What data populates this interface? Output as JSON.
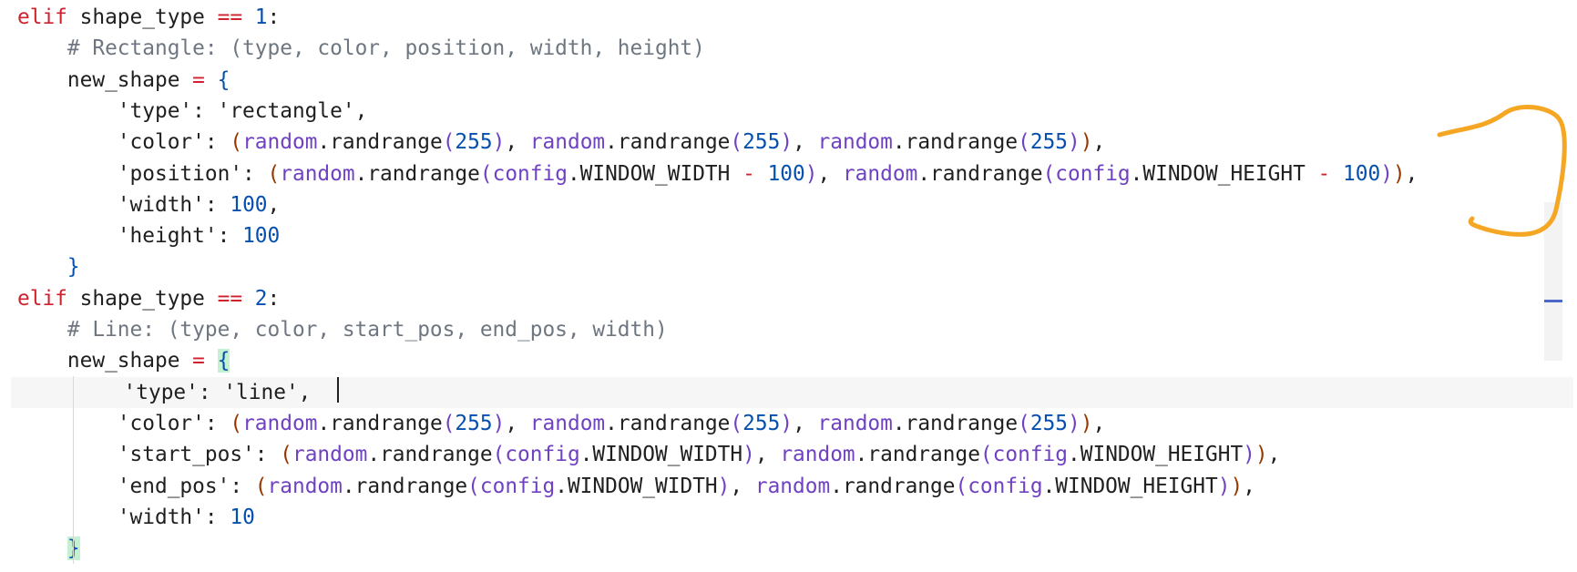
{
  "editor": {
    "lines": [
      {
        "indent": "",
        "tokens": [
          [
            "kw",
            "elif"
          ],
          [
            "pl",
            " shape_type "
          ],
          [
            "op",
            "=="
          ],
          [
            "pl",
            " "
          ],
          [
            "num",
            "1"
          ],
          [
            "pl",
            ":"
          ]
        ]
      },
      {
        "indent": "    ",
        "tokens": [
          [
            "cm",
            "# Rectangle: (type, color, position, width, height)"
          ]
        ]
      },
      {
        "indent": "    ",
        "tokens": [
          [
            "pl",
            "new_shape "
          ],
          [
            "op",
            "="
          ],
          [
            "pl",
            " "
          ],
          [
            "br1",
            "{"
          ]
        ]
      },
      {
        "indent": "        ",
        "tokens": [
          [
            "pl",
            "'type': 'rectangle',"
          ]
        ]
      },
      {
        "indent": "        ",
        "tokens": [
          [
            "pl",
            "'color': "
          ],
          [
            "br2",
            "("
          ],
          [
            "fn",
            "random"
          ],
          [
            "pl",
            ".randrange"
          ],
          [
            "fn",
            "("
          ],
          [
            "num",
            "255"
          ],
          [
            "fn",
            ")"
          ],
          [
            "pl",
            ", "
          ],
          [
            "fn",
            "random"
          ],
          [
            "pl",
            ".randrange"
          ],
          [
            "fn",
            "("
          ],
          [
            "num",
            "255"
          ],
          [
            "fn",
            ")"
          ],
          [
            "pl",
            ", "
          ],
          [
            "fn",
            "random"
          ],
          [
            "pl",
            ".randrange"
          ],
          [
            "fn",
            "("
          ],
          [
            "num",
            "255"
          ],
          [
            "fn",
            ")"
          ],
          [
            "br2",
            ")"
          ],
          [
            "pl",
            ","
          ]
        ]
      },
      {
        "indent": "        ",
        "tokens": [
          [
            "pl",
            "'position': "
          ],
          [
            "br2",
            "("
          ],
          [
            "fn",
            "random"
          ],
          [
            "pl",
            ".randrange"
          ],
          [
            "fn",
            "("
          ],
          [
            "fn",
            "config"
          ],
          [
            "pl",
            ".WINDOW_WIDTH "
          ],
          [
            "op",
            "-"
          ],
          [
            "pl",
            " "
          ],
          [
            "num",
            "100"
          ],
          [
            "fn",
            ")"
          ],
          [
            "pl",
            ", "
          ],
          [
            "fn",
            "random"
          ],
          [
            "pl",
            ".randrange"
          ],
          [
            "fn",
            "("
          ],
          [
            "fn",
            "config"
          ],
          [
            "pl",
            ".WINDOW_HEIGHT "
          ],
          [
            "op",
            "-"
          ],
          [
            "pl",
            " "
          ],
          [
            "num",
            "100"
          ],
          [
            "fn",
            ")"
          ],
          [
            "br2",
            ")"
          ],
          [
            "pl",
            ","
          ]
        ]
      },
      {
        "indent": "        ",
        "tokens": [
          [
            "pl",
            "'width': "
          ],
          [
            "num",
            "100"
          ],
          [
            "pl",
            ","
          ]
        ]
      },
      {
        "indent": "        ",
        "tokens": [
          [
            "pl",
            "'height': "
          ],
          [
            "num",
            "100"
          ]
        ]
      },
      {
        "indent": "    ",
        "tokens": [
          [
            "br1",
            "}"
          ]
        ]
      },
      {
        "indent": "",
        "tokens": [
          [
            "kw",
            "elif"
          ],
          [
            "pl",
            " shape_type "
          ],
          [
            "op",
            "=="
          ],
          [
            "pl",
            " "
          ],
          [
            "num",
            "2"
          ],
          [
            "pl",
            ":"
          ]
        ]
      },
      {
        "indent": "    ",
        "tokens": [
          [
            "cm",
            "# Line: (type, color, start_pos, end_pos, width)"
          ]
        ]
      },
      {
        "indent": "    ",
        "tokens": [
          [
            "pl",
            "new_shape "
          ],
          [
            "op",
            "="
          ],
          [
            "pl",
            " "
          ],
          [
            "br-match",
            "{"
          ]
        ]
      },
      {
        "indent": "        ",
        "current": true,
        "tokens": [
          [
            "pl",
            "'type': 'line',"
          ]
        ]
      },
      {
        "indent": "        ",
        "tokens": [
          [
            "pl",
            "'color': "
          ],
          [
            "br2",
            "("
          ],
          [
            "fn",
            "random"
          ],
          [
            "pl",
            ".randrange"
          ],
          [
            "fn",
            "("
          ],
          [
            "num",
            "255"
          ],
          [
            "fn",
            ")"
          ],
          [
            "pl",
            ", "
          ],
          [
            "fn",
            "random"
          ],
          [
            "pl",
            ".randrange"
          ],
          [
            "fn",
            "("
          ],
          [
            "num",
            "255"
          ],
          [
            "fn",
            ")"
          ],
          [
            "pl",
            ", "
          ],
          [
            "fn",
            "random"
          ],
          [
            "pl",
            ".randrange"
          ],
          [
            "fn",
            "("
          ],
          [
            "num",
            "255"
          ],
          [
            "fn",
            ")"
          ],
          [
            "br2",
            ")"
          ],
          [
            "pl",
            ","
          ]
        ]
      },
      {
        "indent": "        ",
        "tokens": [
          [
            "pl",
            "'start_pos': "
          ],
          [
            "br2",
            "("
          ],
          [
            "fn",
            "random"
          ],
          [
            "pl",
            ".randrange"
          ],
          [
            "fn",
            "("
          ],
          [
            "fn",
            "config"
          ],
          [
            "pl",
            ".WINDOW_WIDTH"
          ],
          [
            "fn",
            ")"
          ],
          [
            "pl",
            ", "
          ],
          [
            "fn",
            "random"
          ],
          [
            "pl",
            ".randrange"
          ],
          [
            "fn",
            "("
          ],
          [
            "fn",
            "config"
          ],
          [
            "pl",
            ".WINDOW_HEIGHT"
          ],
          [
            "fn",
            ")"
          ],
          [
            "br2",
            ")"
          ],
          [
            "pl",
            ","
          ]
        ]
      },
      {
        "indent": "        ",
        "tokens": [
          [
            "pl",
            "'end_pos': "
          ],
          [
            "br2",
            "("
          ],
          [
            "fn",
            "random"
          ],
          [
            "pl",
            ".randrange"
          ],
          [
            "fn",
            "("
          ],
          [
            "fn",
            "config"
          ],
          [
            "pl",
            ".WINDOW_WIDTH"
          ],
          [
            "fn",
            ")"
          ],
          [
            "pl",
            ", "
          ],
          [
            "fn",
            "random"
          ],
          [
            "pl",
            ".randrange"
          ],
          [
            "fn",
            "("
          ],
          [
            "fn",
            "config"
          ],
          [
            "pl",
            ".WINDOW_HEIGHT"
          ],
          [
            "fn",
            ")"
          ],
          [
            "br2",
            ")"
          ],
          [
            "pl",
            ","
          ]
        ]
      },
      {
        "indent": "        ",
        "tokens": [
          [
            "pl",
            "'width': "
          ],
          [
            "num",
            "10"
          ]
        ]
      },
      {
        "indent": "    ",
        "tokens": [
          [
            "br-match",
            "}"
          ]
        ]
      }
    ]
  },
  "colors": {
    "annotation": "#f5a623",
    "cursor": "#1f1f1f"
  }
}
